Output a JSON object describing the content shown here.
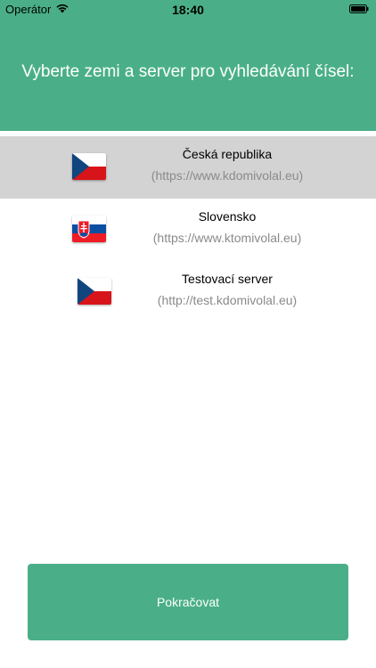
{
  "status_bar": {
    "carrier": "Operátor",
    "time": "18:40",
    "wifi_icon": "wifi-icon",
    "battery_icon": "battery-icon"
  },
  "header": {
    "title": "Vyberte zemi a server pro vyhledávání čísel:",
    "color": "#4aaf89"
  },
  "servers": [
    {
      "name": "Česká republika",
      "url": "(https://www.kdomivolal.eu)",
      "flag": "czech-flag",
      "selected": true
    },
    {
      "name": "Slovensko",
      "url": "(https://www.ktomivolal.eu)",
      "flag": "slovak-flag",
      "selected": false
    },
    {
      "name": "Testovací server",
      "url": "(http://test.kdomivolal.eu)",
      "flag": "czech-flag",
      "selected": false
    }
  ],
  "continue_button": {
    "label": "Pokračovat"
  },
  "colors": {
    "accent": "#4aaf89",
    "selected_row": "#d3d3d3",
    "url_text": "#8a8a8a"
  }
}
